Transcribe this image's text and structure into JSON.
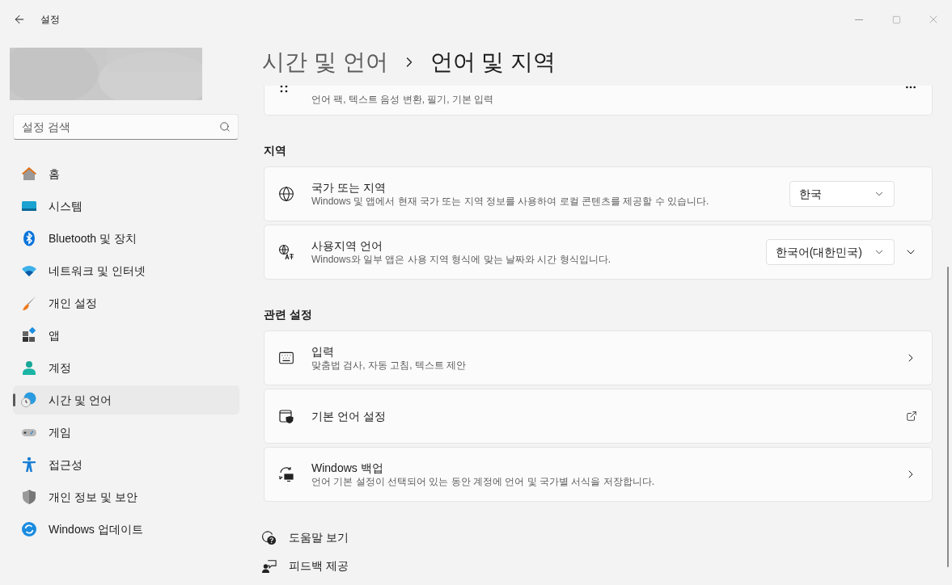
{
  "window": {
    "title": "설정"
  },
  "search": {
    "placeholder": "설정 검색"
  },
  "nav": [
    {
      "label": "홈",
      "selected": false
    },
    {
      "label": "시스템",
      "selected": false
    },
    {
      "label": "Bluetooth 및 장치",
      "selected": false
    },
    {
      "label": "네트워크 및 인터넷",
      "selected": false
    },
    {
      "label": "개인 설정",
      "selected": false
    },
    {
      "label": "앱",
      "selected": false
    },
    {
      "label": "계정",
      "selected": false
    },
    {
      "label": "시간 및 언어",
      "selected": true
    },
    {
      "label": "게임",
      "selected": false
    },
    {
      "label": "접근성",
      "selected": false
    },
    {
      "label": "개인 정보 및 보안",
      "selected": false
    },
    {
      "label": "Windows 업데이트",
      "selected": false
    }
  ],
  "breadcrumb": {
    "parent": "시간 및 언어",
    "current": "언어 및 지역"
  },
  "partial_card": {
    "subtitle": "언어 팩, 텍스트 음성 변환, 필기, 기본 입력"
  },
  "sections": [
    {
      "title": "지역",
      "rows": [
        {
          "kind": "dropdown",
          "title": "국가 또는 지역",
          "subtitle": "Windows 및 앱에서 현재 국가 또는 지역 정보를 사용하여 로컬 콘텐츠를 제공할 수 있습니다.",
          "value": "한국"
        },
        {
          "kind": "expandable-dropdown",
          "title": "사용지역 언어",
          "subtitle": "Windows와 일부 앱은 사용 지역 형식에 맞는 날짜와 시간 형식입니다.",
          "value": "한국어(대한민국)"
        }
      ]
    },
    {
      "title": "관련 설정",
      "rows": [
        {
          "kind": "link",
          "title": "입력",
          "subtitle": "맞춤법 검사, 자동 고침, 텍스트 제안"
        },
        {
          "kind": "external",
          "title": "기본 언어 설정"
        },
        {
          "kind": "link",
          "title": "Windows 백업",
          "subtitle": "언어 기본 설정이 선택되어 있는 동안 계정에 언어 및 국가별 서식을 저장합니다."
        }
      ]
    }
  ],
  "footer_links": [
    {
      "label": "도움말 보기"
    },
    {
      "label": "피드백 제공"
    }
  ]
}
